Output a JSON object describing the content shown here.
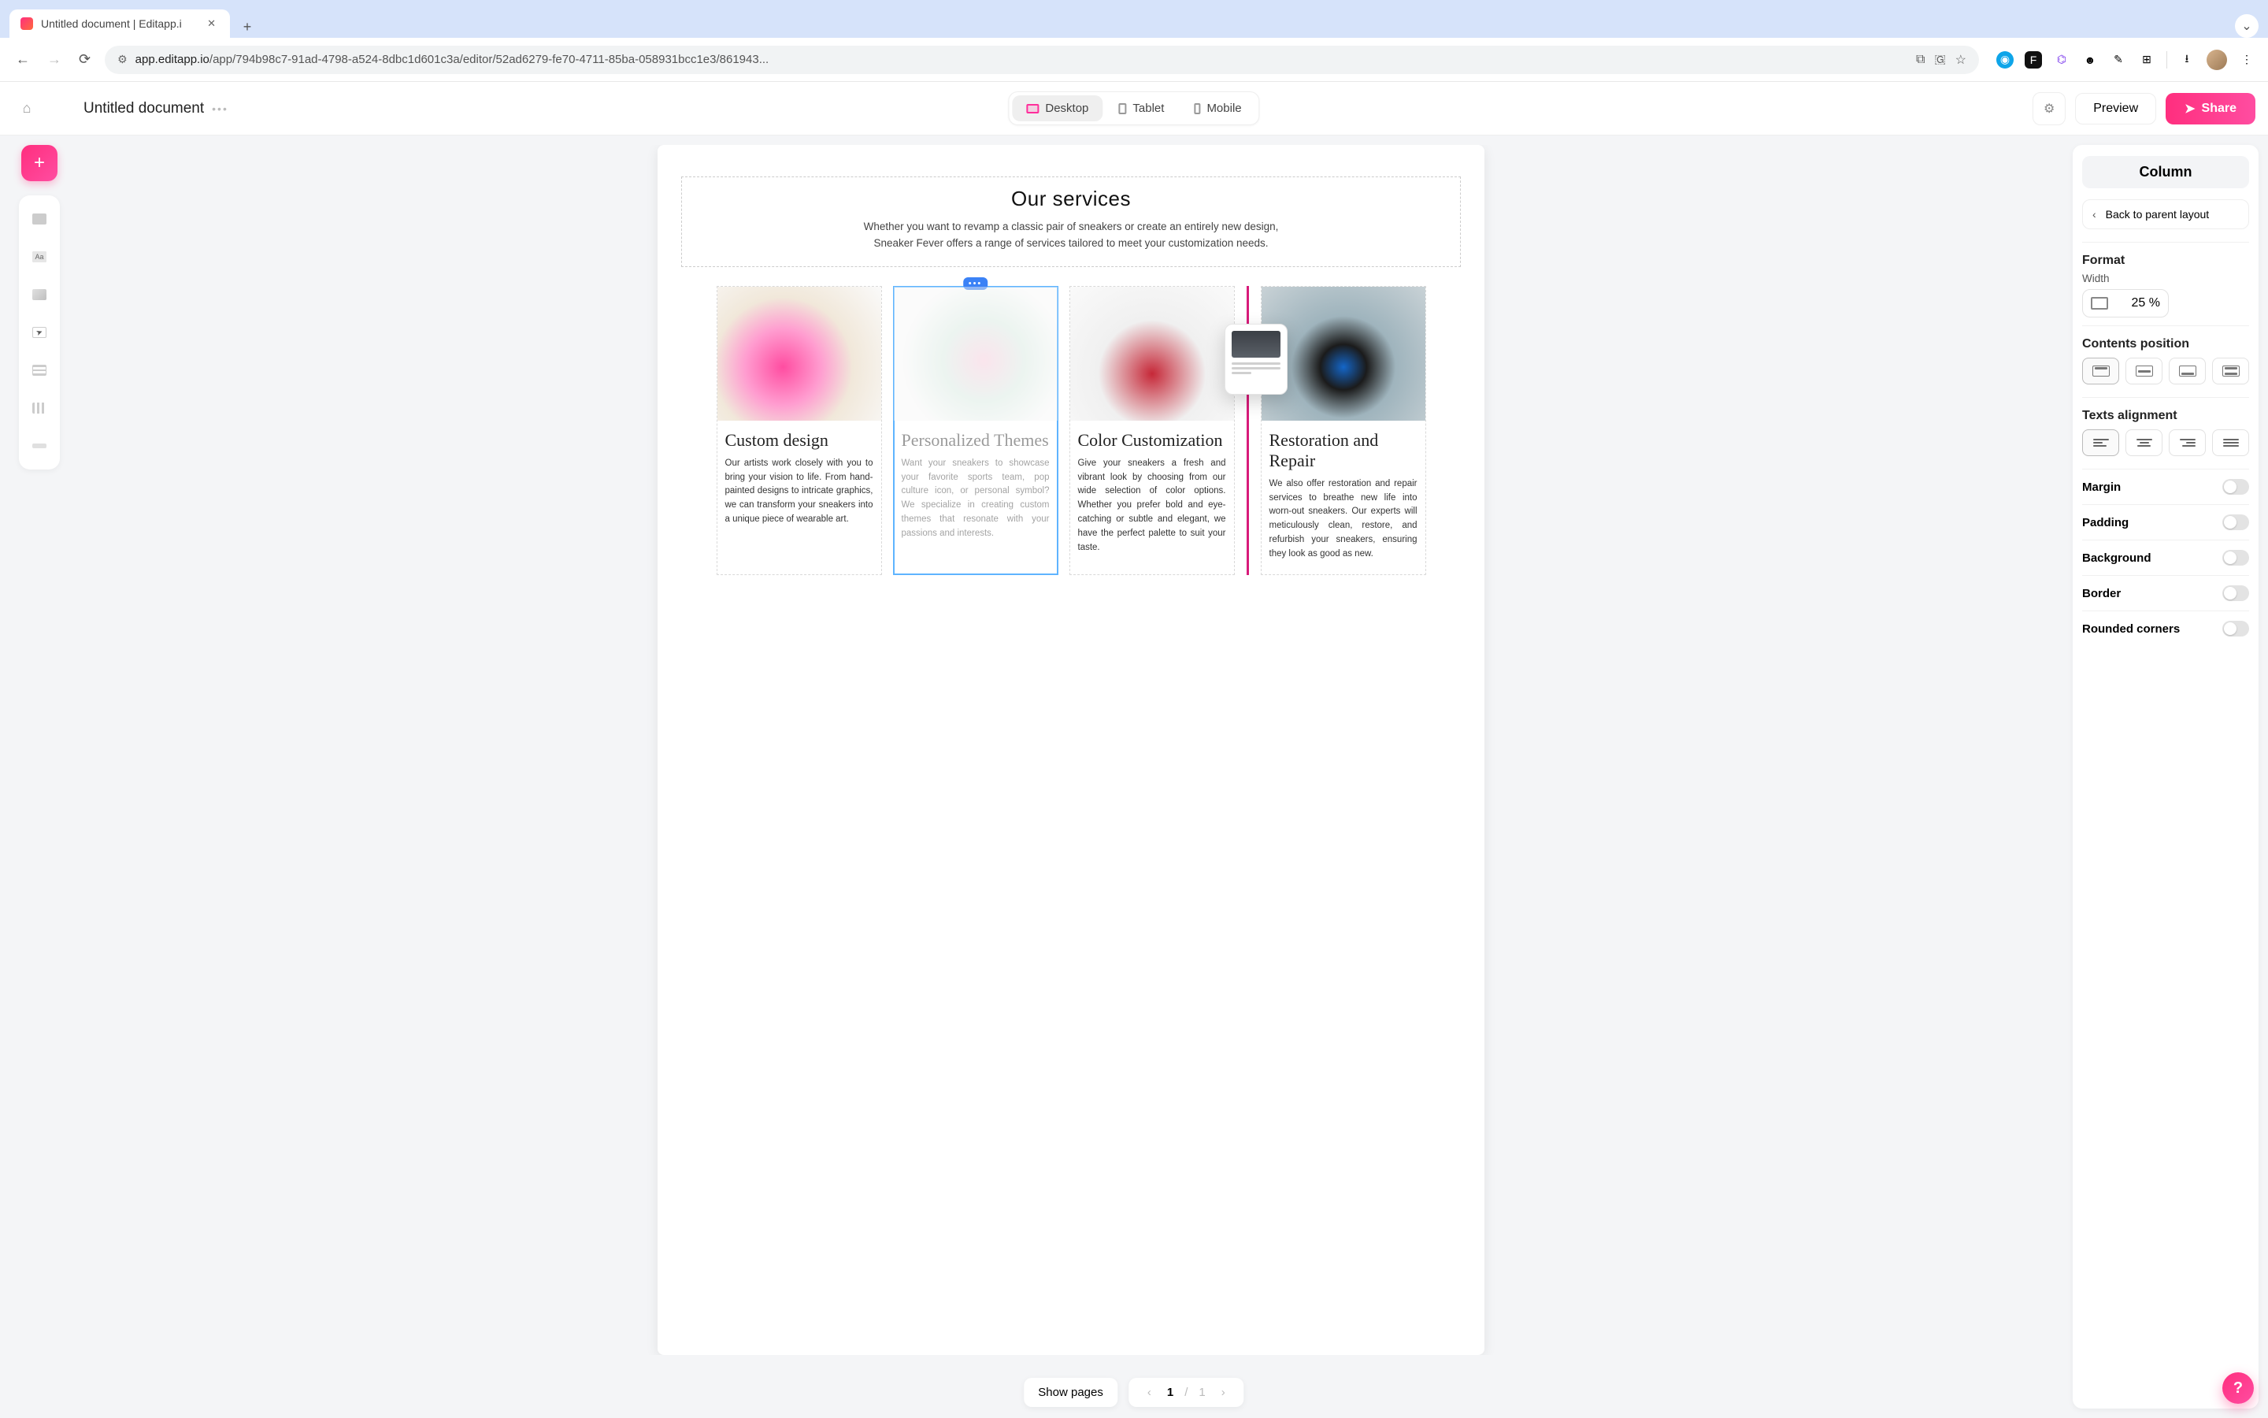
{
  "browser": {
    "tab_title": "Untitled document | Editapp.i",
    "url_domain": "app.editapp.io",
    "url_path": "/app/794b98c7-91ad-4798-a524-8dbc1d601c3a/editor/52ad6279-fe70-4711-85ba-058931bcc1e3/861943..."
  },
  "header": {
    "document_title": "Untitled document",
    "devices": {
      "desktop": "Desktop",
      "tablet": "Tablet",
      "mobile": "Mobile",
      "active": "desktop"
    },
    "preview": "Preview",
    "share": "Share"
  },
  "leftRail": {
    "items": [
      "placeholder-block",
      "text-block",
      "image-block",
      "button-block",
      "cursor-tool",
      "grid-tool",
      "chart-tool",
      "spacer-tool"
    ]
  },
  "canvas": {
    "section_title": "Our services",
    "section_desc_line1": "Whether you want to revamp a classic pair of sneakers or create an entirely new design,",
    "section_desc_line2": "Sneaker Fever offers a range of services tailored to meet your customization needs.",
    "cards": [
      {
        "title": "Custom design",
        "text": "Our artists work closely with you to bring your vision to life. From hand-painted designs to intricate graphics, we can transform your sneakers into a unique piece of wearable art."
      },
      {
        "title": "Personalized Themes",
        "text": "Want your sneakers to showcase your favorite sports team, pop culture icon, or personal symbol? We specialize in creating custom themes that resonate with your passions and interests.",
        "selected": true
      },
      {
        "title": "Color Customization",
        "text": "Give your sneakers a fresh and vibrant look by choosing from our wide selection of color options. Whether you prefer bold and eye-catching or subtle and elegant, we have the perfect palette to suit your taste."
      },
      {
        "title": "Restoration and Repair",
        "text": "We also offer restoration and repair services to breathe new life into worn-out sneakers. Our experts will meticulously clean, restore, and refurbish your sneakers, ensuring they look as good as new."
      }
    ],
    "selected_handle": "•••"
  },
  "inspector": {
    "title": "Column",
    "back_label": "Back to parent layout",
    "format_label": "Format",
    "width_label": "Width",
    "width_value": "25 %",
    "contents_position_label": "Contents position",
    "texts_alignment_label": "Texts alignment",
    "toggles": {
      "margin": "Margin",
      "padding": "Padding",
      "background": "Background",
      "border": "Border",
      "rounded": "Rounded corners"
    }
  },
  "pager": {
    "show_pages": "Show pages",
    "current": "1",
    "total": "1"
  },
  "help": "?"
}
